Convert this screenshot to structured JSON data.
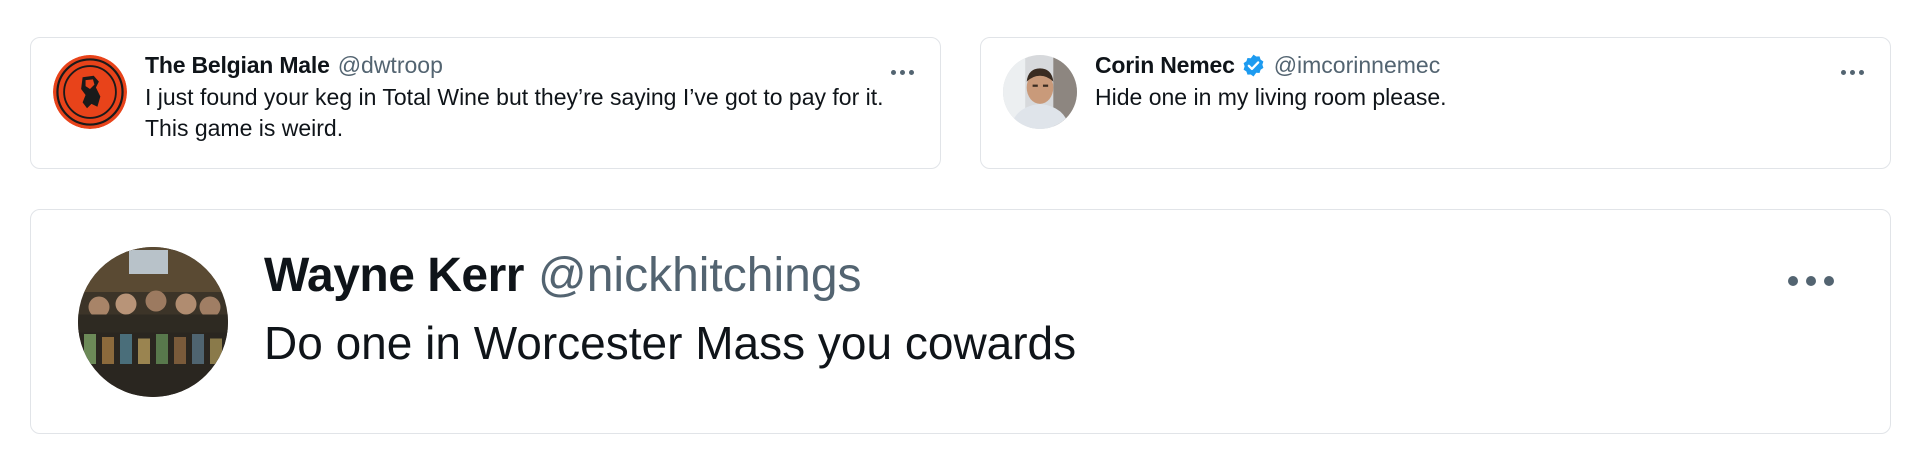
{
  "tweets": [
    {
      "name": "The Belgian Male",
      "handle": "@dwtroop",
      "verified": false,
      "text_lines": [
        "I just found your keg in Total Wine but they’re saying I’ve got to pay for it.",
        "This game is weird."
      ],
      "avatar_icon": "chelsea-fc-crest-avatar"
    },
    {
      "name": "Corin Nemec",
      "handle": "@imcorinnemec",
      "verified": true,
      "text_lines": [
        "Hide one in my living room please."
      ],
      "avatar_icon": "man-portrait-avatar"
    },
    {
      "name": "Wayne Kerr",
      "handle": "@nickhitchings",
      "verified": false,
      "text_lines": [
        "Do one in Worcester Mass you cowards"
      ],
      "avatar_icon": "bar-group-photo-avatar"
    }
  ],
  "colors": {
    "text_primary": "#0f1419",
    "text_secondary": "#536471",
    "border": "#e1e4e8",
    "verified_blue": "#1d9bf0",
    "chelsea_orange": "#e8431a"
  }
}
